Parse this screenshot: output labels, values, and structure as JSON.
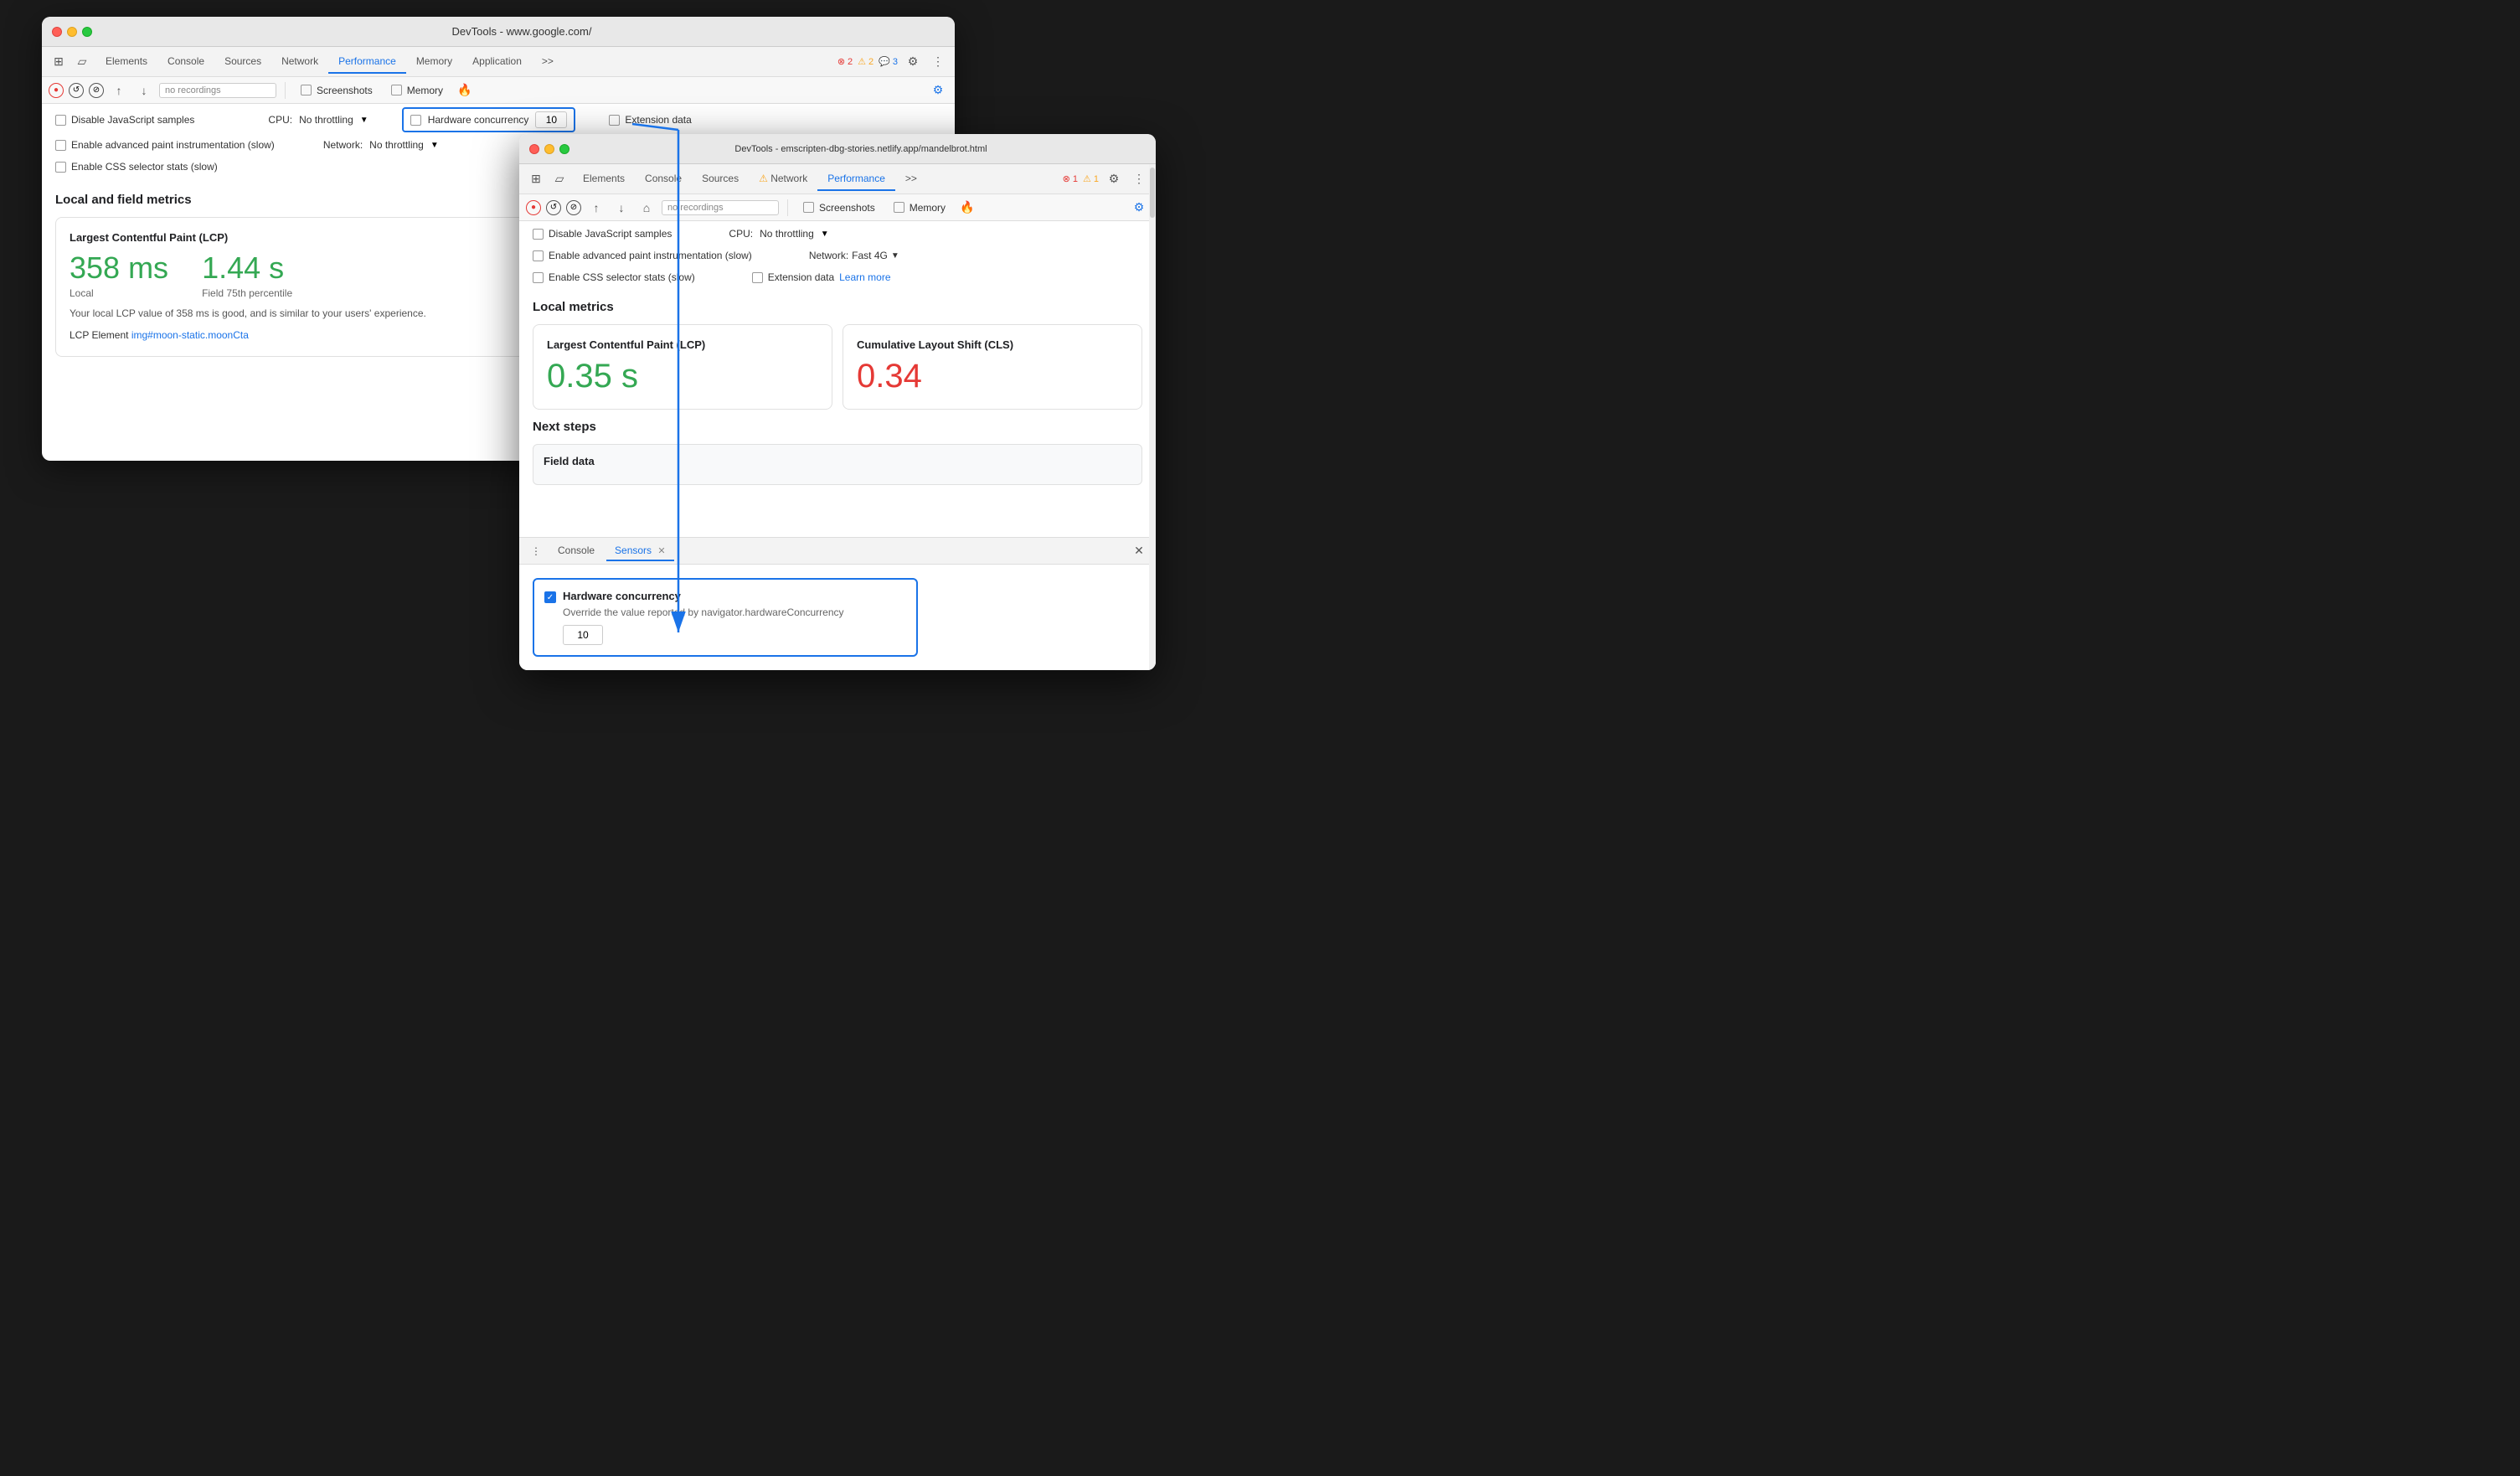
{
  "back_window": {
    "title": "DevTools - www.google.com/",
    "traffic_lights": [
      "red",
      "yellow",
      "green"
    ],
    "tabs": [
      {
        "label": "Elements",
        "active": false
      },
      {
        "label": "Console",
        "active": false
      },
      {
        "label": "Sources",
        "active": false
      },
      {
        "label": "Network",
        "active": false
      },
      {
        "label": "Performance",
        "active": true
      },
      {
        "label": "Memory",
        "active": false
      },
      {
        "label": "Application",
        "active": false
      },
      {
        "label": ">>",
        "active": false
      }
    ],
    "badges": {
      "error": "2",
      "warn": "2",
      "info": "3"
    },
    "toolbar2": {
      "recordings_placeholder": "no recordings"
    },
    "checkboxes": {
      "screenshots": "Screenshots",
      "memory": "Memory"
    },
    "options": {
      "disable_js": "Disable JavaScript samples",
      "enable_paint": "Enable advanced paint instrumentation (slow)",
      "enable_css": "Enable CSS selector stats (slow)",
      "cpu_label": "CPU:",
      "cpu_value": "No throttling",
      "network_label": "Network:",
      "network_value": "No throttling",
      "hw_concurrency_label": "Hardware concurrency",
      "hw_concurrency_value": "10",
      "extension_data": "Extension data"
    },
    "content": {
      "section_title": "Local and field metrics",
      "lcp_card": {
        "title": "Largest Contentful Paint (LCP)",
        "local_value": "358 ms",
        "local_label": "Local",
        "field_value": "1.44 s",
        "field_label": "Field 75th percentile",
        "description": "Your local LCP value of 358 ms is good, and is similar to your users' experience.",
        "lcp_element": "LCP Element",
        "lcp_selector": "img#moon-static.moonCta"
      }
    }
  },
  "front_window": {
    "title": "DevTools - emscripten-dbg-stories.netlify.app/mandelbrot.html",
    "tabs": [
      {
        "label": "Elements",
        "active": false
      },
      {
        "label": "Console",
        "active": false
      },
      {
        "label": "Sources",
        "active": false
      },
      {
        "label": "Network",
        "active": false
      },
      {
        "label": "Performance",
        "active": true
      },
      {
        "label": ">>",
        "active": false
      }
    ],
    "badges": {
      "error": "1",
      "warn": "1"
    },
    "toolbar2": {
      "recordings_placeholder": "no recordings"
    },
    "checkboxes": {
      "screenshots": "Screenshots",
      "memory": "Memory"
    },
    "options": {
      "disable_js": "Disable JavaScript samples",
      "enable_paint": "Enable advanced paint instrumentation (slow)",
      "enable_css": "Enable CSS selector stats (slow)",
      "cpu_label": "CPU:",
      "cpu_value": "No throttling",
      "network_label": "Network:",
      "network_value": "Fast 4G",
      "extension_data": "Extension data",
      "learn_more": "Learn more"
    },
    "content": {
      "section_title": "Local metrics",
      "lcp_card": {
        "title": "Largest Contentful Paint (LCP)",
        "value": "0.35 s"
      },
      "cls_card": {
        "title": "Cumulative Layout Shift (CLS)",
        "value": "0.34"
      },
      "next_steps_title": "Next steps",
      "field_data_title": "Field data"
    },
    "bottom_panel": {
      "tabs": [
        {
          "label": "Console",
          "active": false,
          "closeable": false
        },
        {
          "label": "Sensors",
          "active": true,
          "closeable": true
        }
      ],
      "sensors": {
        "hw_concurrency_label": "Hardware concurrency",
        "hw_concurrency_desc": "Override the value reported by navigator.hardwareConcurrency",
        "hw_concurrency_value": "10"
      }
    }
  },
  "arrow": {
    "color": "#1a73e8",
    "description": "Blue arrow pointing from Hardware concurrency checkbox to Sensors panel"
  }
}
